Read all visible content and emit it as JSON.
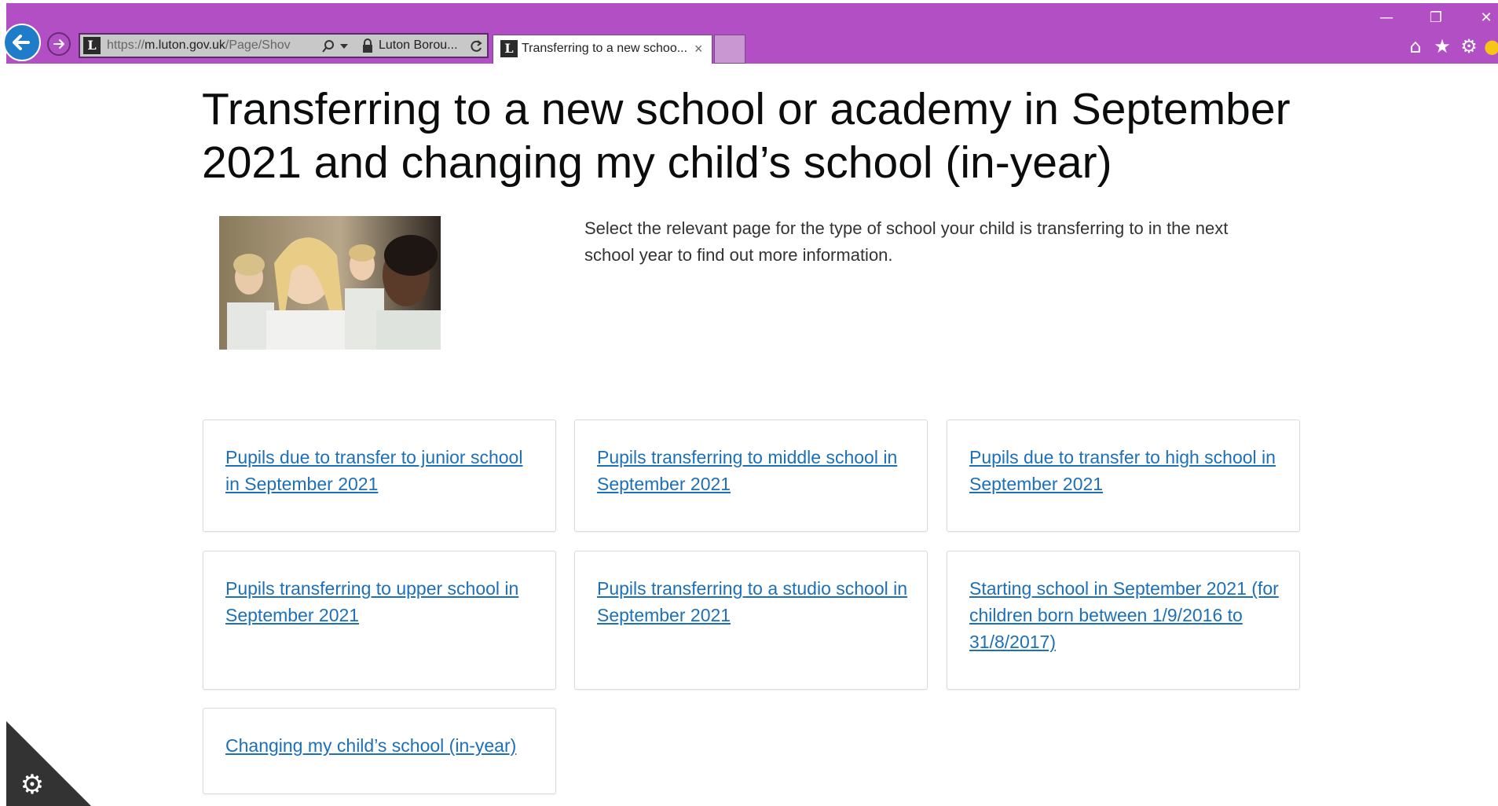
{
  "browser": {
    "url_prefix": "https://",
    "url_host": "m.luton.gov.uk",
    "url_path": "/Page/Shov",
    "site_label": "Luton Borou...",
    "tab_title": "Transferring to a new schoo...",
    "tab_close": "×",
    "icons": [
      "minimize-icon",
      "restore-icon",
      "close-icon",
      "back-arrow-icon",
      "forward-arrow-icon",
      "search-icon",
      "dropdown-icon",
      "lock-icon",
      "refresh-icon",
      "home-icon",
      "star-icon",
      "gear-icon",
      "smiley-icon"
    ],
    "chrome_color": "#b24fc4"
  },
  "page": {
    "title": "Transferring to a new school or academy in September 2021 and changing my child’s school (in-year)",
    "intro": "Select the relevant page for the type of school your child is transferring to in the next school year to find out more information.",
    "link_color": "#1d70b8"
  },
  "cards": [
    {
      "label": "Pupils due to transfer to junior school in September 2021"
    },
    {
      "label": "Pupils transferring to middle school in September 2021"
    },
    {
      "label": "Pupils due to transfer to high school in September 2021"
    },
    {
      "label": "Pupils transferring to upper school in September 2021"
    },
    {
      "label": "Pupils transferring to a studio school in September 2021"
    },
    {
      "label": "Starting school in September 2021 (for children born between 1/9/2016 to 31/8/2017)"
    },
    {
      "label": "Changing my child’s school (in-year)"
    }
  ],
  "cookie_widget": {
    "icon": "cookie-settings-icon"
  }
}
